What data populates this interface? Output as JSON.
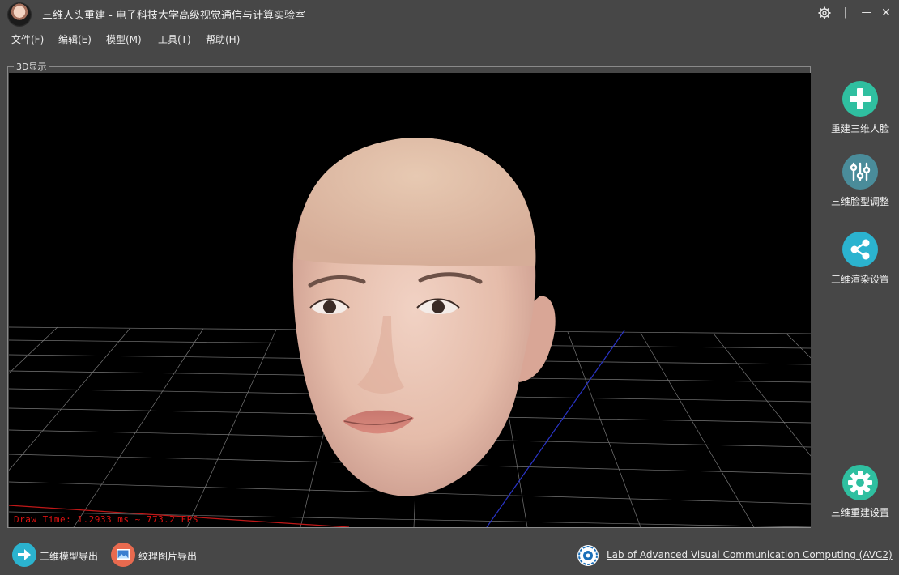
{
  "window": {
    "title": "三维人头重建 - 电子科技大学高级视觉通信与计算实验室",
    "controls": {
      "settings": "⚙",
      "separator": "|",
      "minimize": "—",
      "close": "✕"
    }
  },
  "menu": [
    {
      "label": "文件(F)"
    },
    {
      "label": "编辑(E)"
    },
    {
      "label": "模型(M)"
    },
    {
      "label": "工具(T)"
    },
    {
      "label": "帮助(H)"
    }
  ],
  "viewport": {
    "group_label": "3D显示",
    "status_text": "Draw Time: 1.2933 ms ~ 773.2 FPS",
    "background": "#000000"
  },
  "side_buttons": [
    {
      "label": "重建三维人脸",
      "icon": "plus-icon",
      "color": "#2fbfa0"
    },
    {
      "label": "三维脸型调整",
      "icon": "sliders-icon",
      "color": "#4a8c9a"
    },
    {
      "label": "三维渲染设置",
      "icon": "share-icon",
      "color": "#2bb3cf"
    },
    {
      "label": "三维重建设置",
      "icon": "gear-icon",
      "color": "#2fbfa0"
    }
  ],
  "bottom": {
    "export_model_label": "三维模型导出",
    "export_texture_label": "纹理图片导出",
    "lab_link": "Lab of Advanced Visual Communication  Computing (AVC2)"
  },
  "colors": {
    "background": "#474747",
    "status_red": "#d11111"
  }
}
